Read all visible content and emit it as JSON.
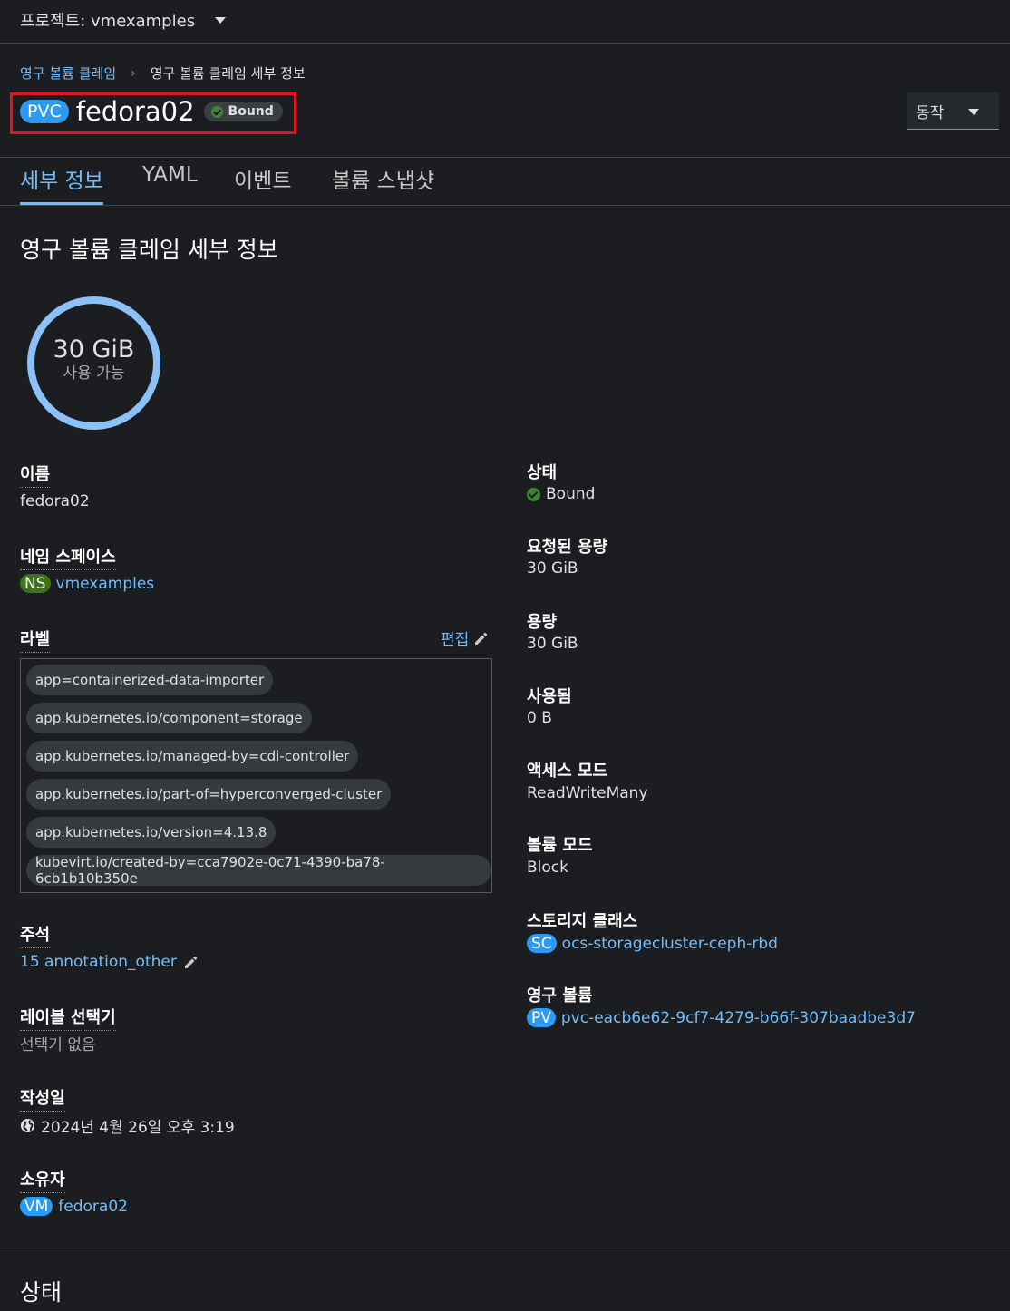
{
  "project": {
    "label": "프로젝트: vmexamples"
  },
  "breadcrumb": {
    "parent": "영구 볼륨 클레임",
    "separator": "›",
    "current": "영구 볼륨 클레임 세부 정보"
  },
  "header": {
    "kind_badge": "PVC",
    "title": "fedora02",
    "status": "Bound",
    "actions_label": "동작"
  },
  "tabs": [
    {
      "label": "세부 정보",
      "active": true
    },
    {
      "label": "YAML"
    },
    {
      "label": "이벤트"
    },
    {
      "label": "볼륨 스냅샷"
    }
  ],
  "section_title": "영구 볼륨 클레임 세부 정보",
  "donut": {
    "value": "30 GiB",
    "label": "사용 가능"
  },
  "left": {
    "name": {
      "label": "이름",
      "value": "fedora02"
    },
    "namespace": {
      "label": "네임 스페이스",
      "badge": "NS",
      "value": "vmexamples"
    },
    "labels": {
      "label": "라벨",
      "edit": "편집",
      "items": [
        "app=containerized-data-importer",
        "app.kubernetes.io/component=storage",
        "app.kubernetes.io/managed-by=cdi-controller",
        "app.kubernetes.io/part-of=hyperconverged-cluster",
        "app.kubernetes.io/version=4.13.8",
        "kubevirt.io/created-by=cca7902e-0c71-4390-ba78-6cb1b10b350e"
      ]
    },
    "annotations": {
      "label": "주석",
      "value": "15 annotation_other"
    },
    "selector": {
      "label": "레이블 선택기",
      "value": "선택기 없음"
    },
    "created": {
      "label": "작성일",
      "value": "2024년 4월 26일 오후 3:19"
    },
    "owner": {
      "label": "소유자",
      "badge": "VM",
      "value": "fedora02"
    }
  },
  "right": {
    "status": {
      "label": "상태",
      "value": "Bound"
    },
    "requested": {
      "label": "요청된 용량",
      "value": "30 GiB"
    },
    "capacity": {
      "label": "용량",
      "value": "30 GiB"
    },
    "used": {
      "label": "사용됨",
      "value": "0 B"
    },
    "access_mode": {
      "label": "액세스 모드",
      "value": "ReadWriteMany"
    },
    "volume_mode": {
      "label": "볼륨 모드",
      "value": "Block"
    },
    "storage_class": {
      "label": "스토리지 클래스",
      "badge": "SC",
      "value": "ocs-storagecluster-ceph-rbd"
    },
    "pv": {
      "label": "영구 볼륨",
      "badge": "PV",
      "value": "pvc-eacb6e62-9cf7-4279-b66f-307baadbe3d7"
    }
  },
  "bottom_section_title": "상태",
  "colors": {
    "accent": "#73bcf7",
    "badge_blue": "#2b9af3",
    "ns_green": "#3d7317",
    "success": "#3e8635",
    "highlight": "#e2141d"
  }
}
